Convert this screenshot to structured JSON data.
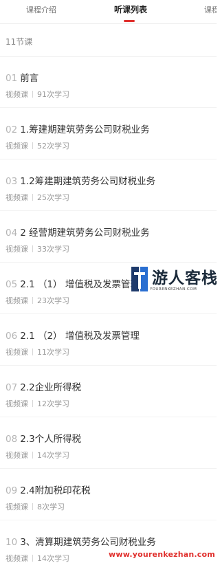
{
  "tabs": [
    {
      "label": "课程介绍"
    },
    {
      "label": "听课列表"
    },
    {
      "label": "课程"
    }
  ],
  "lesson_count": "11节课",
  "lessons": [
    {
      "num": "01",
      "title": "前言",
      "type": "视频课",
      "views": "91次学习"
    },
    {
      "num": "02",
      "title": "1.筹建期建筑劳务公司财税业务",
      "type": "视频课",
      "views": "52次学习"
    },
    {
      "num": "03",
      "title": "1.2筹建期建筑劳务公司财税业务",
      "type": "视频课",
      "views": "25次学习"
    },
    {
      "num": "04",
      "title": "2 经营期建筑劳务公司财税业务",
      "type": "视频课",
      "views": "33次学习"
    },
    {
      "num": "05",
      "title": "2.1 （1） 增值税及发票管理",
      "type": "视频课",
      "views": "23次学习"
    },
    {
      "num": "06",
      "title": "2.1 （2） 增值税及发票管理",
      "type": "视频课",
      "views": "11次学习"
    },
    {
      "num": "07",
      "title": "2.2企业所得税",
      "type": "视频课",
      "views": "12次学习"
    },
    {
      "num": "08",
      "title": "2.3个人所得税",
      "type": "视频课",
      "views": "14次学习"
    },
    {
      "num": "09",
      "title": "2.4附加税印花税",
      "type": "视频课",
      "views": "8次学习"
    },
    {
      "num": "10",
      "title": "3、清算期建筑劳务公司财税业务",
      "type": "视频课",
      "views": "14次学习"
    }
  ],
  "watermark": {
    "name": "游人客栈",
    "domain": "YOURENKEZHAN.COM",
    "url": "www.yourenkezhan.com"
  },
  "colors": {
    "accent": "#e0302d",
    "text": "#333333",
    "muted": "#999999"
  }
}
